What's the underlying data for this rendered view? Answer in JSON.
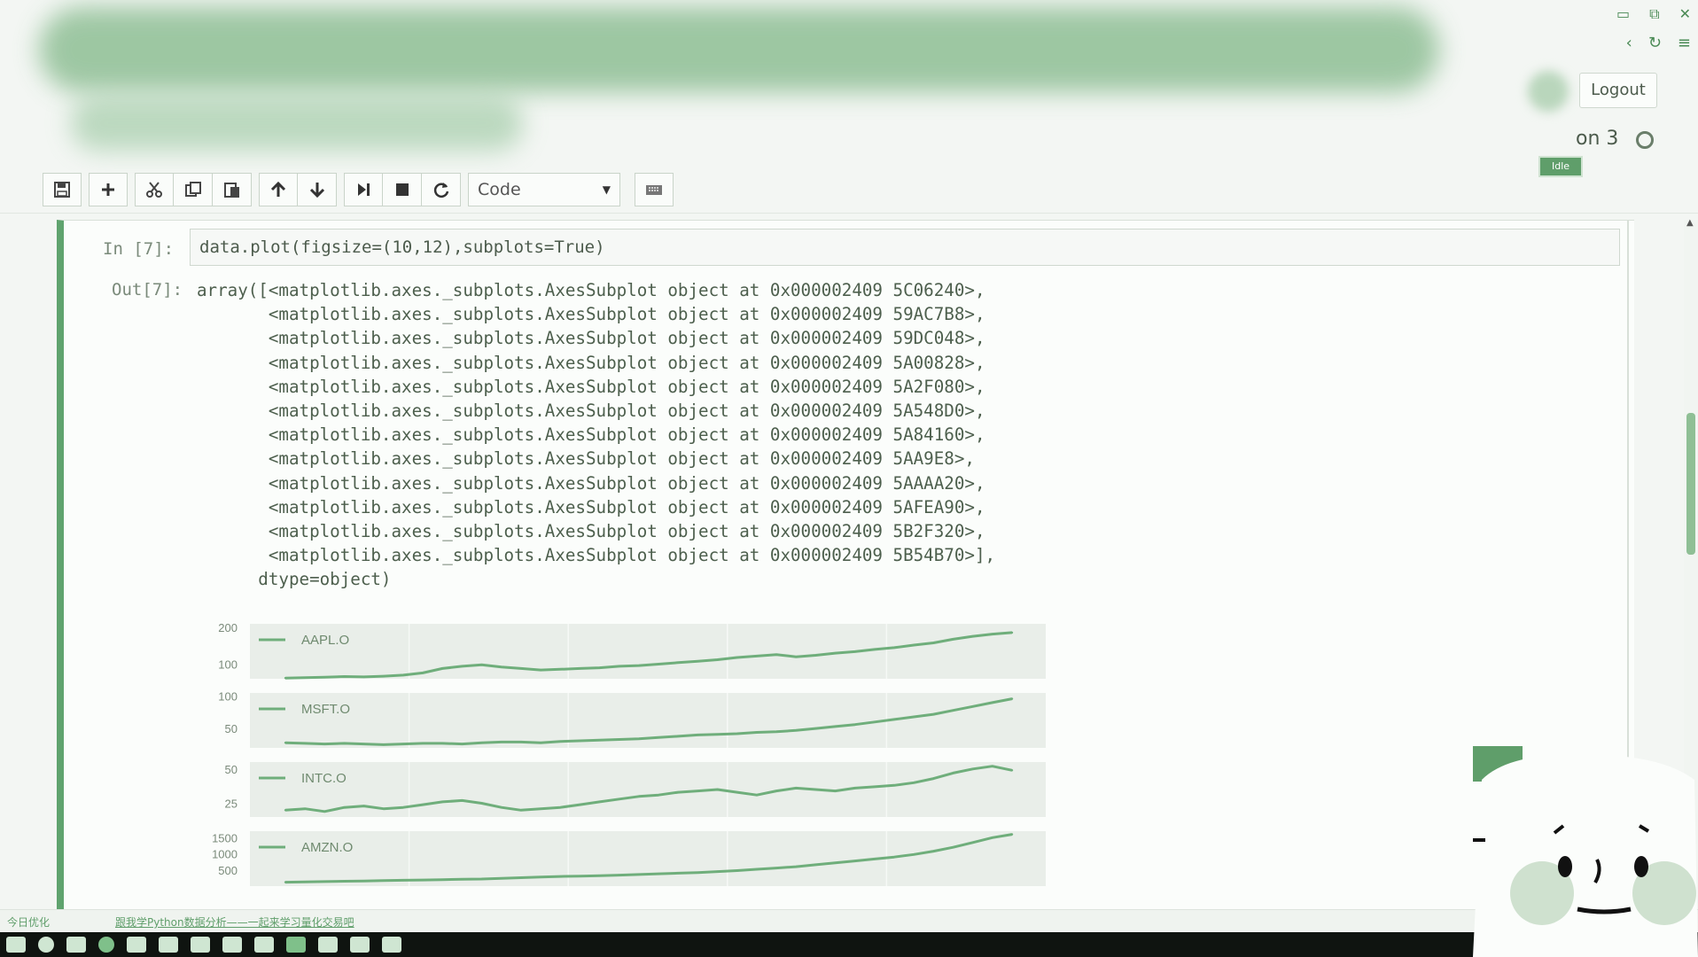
{
  "header": {
    "logout_label": "Logout",
    "kernel_name_fragment": "on 3",
    "kernel_tooltip": "Idle"
  },
  "toolbar": {
    "cell_type_value": "Code",
    "icons": [
      "save-icon",
      "plus-icon",
      "cut-icon",
      "copy-icon",
      "paste-icon",
      "arrow-up-icon",
      "arrow-down-icon",
      "run-icon",
      "stop-icon",
      "restart-icon",
      "keyboard-icon"
    ]
  },
  "cell": {
    "in_prompt": "In [7]:",
    "out_prompt": "Out[7]:",
    "code": "data.plot(figsize=(10,12),subplots=True)",
    "output_lines": [
      "array([<matplotlib.axes._subplots.AxesSubplot object at 0x000002409 5C06240>,",
      "       <matplotlib.axes._subplots.AxesSubplot object at 0x000002409 59AC7B8>,",
      "       <matplotlib.axes._subplots.AxesSubplot object at 0x000002409 59DC048>,",
      "       <matplotlib.axes._subplots.AxesSubplot object at 0x000002409 5A00828>,",
      "       <matplotlib.axes._subplots.AxesSubplot object at 0x000002409 5A2F080>,",
      "       <matplotlib.axes._subplots.AxesSubplot object at 0x000002409 5A548D0>,",
      "       <matplotlib.axes._subplots.AxesSubplot object at 0x000002409 5A84160>,",
      "       <matplotlib.axes._subplots.AxesSubplot object at 0x000002409 5AA9E8>,",
      "       <matplotlib.axes._subplots.AxesSubplot object at 0x000002409 5AAAA20>,",
      "       <matplotlib.axes._subplots.AxesSubplot object at 0x000002409 5AFEA90>,",
      "       <matplotlib.axes._subplots.AxesSubplot object at 0x000002409 5B2F320>,",
      "       <matplotlib.axes._subplots.AxesSubplot object at 0x000002409 5B54B70>],",
      "      dtype=object)"
    ]
  },
  "chart_data": {
    "type": "line",
    "subplots": [
      {
        "name": "AAPL.O",
        "yticks": [
          "200",
          "100"
        ],
        "ylim": [
          60,
          210
        ],
        "values": [
          62,
          63,
          64,
          66,
          65,
          67,
          70,
          76,
          88,
          94,
          98,
          92,
          88,
          84,
          86,
          88,
          90,
          94,
          96,
          100,
          104,
          108,
          112,
          118,
          122,
          126,
          120,
          124,
          130,
          134,
          140,
          145,
          152,
          158,
          168,
          176,
          182,
          186
        ]
      },
      {
        "name": "MSFT.O",
        "yticks": [
          "100",
          "50"
        ],
        "ylim": [
          20,
          105
        ],
        "values": [
          28,
          27,
          26,
          27,
          26,
          25,
          26,
          27,
          27,
          26,
          28,
          29,
          29,
          28,
          30,
          31,
          32,
          33,
          34,
          36,
          38,
          40,
          41,
          42,
          44,
          45,
          47,
          50,
          53,
          56,
          60,
          64,
          68,
          72,
          78,
          84,
          90,
          96
        ]
      },
      {
        "name": "INTC.O",
        "yticks": [
          "50",
          "25"
        ],
        "ylim": [
          15,
          55
        ],
        "values": [
          20,
          21,
          19,
          22,
          23,
          21,
          22,
          24,
          26,
          27,
          25,
          22,
          20,
          21,
          22,
          24,
          26,
          28,
          30,
          31,
          33,
          34,
          35,
          33,
          31,
          34,
          36,
          35,
          34,
          36,
          37,
          38,
          40,
          43,
          47,
          50,
          52,
          49
        ]
      },
      {
        "name": "AMZN.O",
        "yticks": [
          "1500",
          "1000",
          "500"
        ],
        "ylim": [
          0,
          1700
        ],
        "values": [
          120,
          130,
          140,
          150,
          160,
          170,
          180,
          190,
          200,
          210,
          220,
          240,
          260,
          280,
          300,
          310,
          320,
          340,
          360,
          380,
          400,
          420,
          450,
          480,
          520,
          560,
          600,
          660,
          720,
          780,
          840,
          900,
          980,
          1080,
          1200,
          1350,
          1500,
          1600
        ]
      }
    ]
  },
  "status": {
    "left": "今日优化",
    "message": "跟我学Python数据分析——一起来学习量化交易吧"
  }
}
